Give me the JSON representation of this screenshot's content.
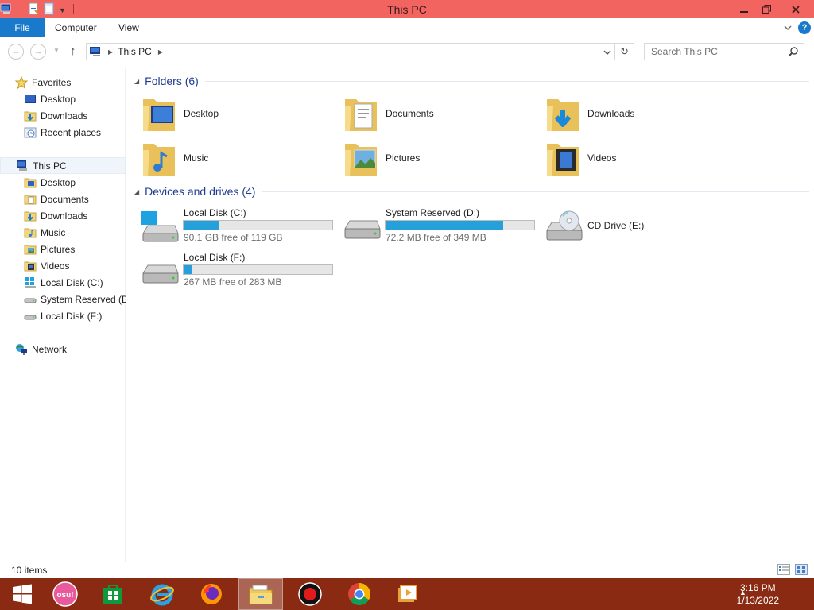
{
  "window": {
    "title": "This PC",
    "qat_icons": [
      "computer-icon",
      "properties-icon",
      "new-folder-icon",
      "customize-qat-icon"
    ],
    "controls": [
      "minimize",
      "restore",
      "close"
    ]
  },
  "ribbon": {
    "file_tab": "File",
    "tabs": [
      "Computer",
      "View"
    ],
    "expand_icon": "chevron-down-icon",
    "help_icon": "help-icon",
    "help_glyph": "?"
  },
  "navbar": {
    "breadcrumb": "This PC",
    "search_placeholder": "Search This PC"
  },
  "sidebar": {
    "favorites": {
      "label": "Favorites",
      "items": [
        "Desktop",
        "Downloads",
        "Recent places"
      ]
    },
    "this_pc": {
      "label": "This PC",
      "items": [
        "Desktop",
        "Documents",
        "Downloads",
        "Music",
        "Pictures",
        "Videos",
        "Local Disk (C:)",
        "System Reserved (D:)",
        "Local Disk (F:)"
      ]
    },
    "network": {
      "label": "Network"
    }
  },
  "folders": {
    "header": "Folders (6)",
    "items": [
      {
        "name": "Desktop",
        "icon": "desktop-folder-icon"
      },
      {
        "name": "Documents",
        "icon": "documents-folder-icon"
      },
      {
        "name": "Downloads",
        "icon": "downloads-folder-icon"
      },
      {
        "name": "Music",
        "icon": "music-folder-icon"
      },
      {
        "name": "Pictures",
        "icon": "pictures-folder-icon"
      },
      {
        "name": "Videos",
        "icon": "videos-folder-icon"
      }
    ]
  },
  "drives": {
    "header": "Devices and drives (4)",
    "items": [
      {
        "name": "Local Disk (C:)",
        "free": "90.1 GB free of 119 GB",
        "used_fraction": 0.24,
        "icon": "windows-drive-icon"
      },
      {
        "name": "System Reserved (D:)",
        "free": "72.2 MB free of 349 MB",
        "used_fraction": 0.79,
        "icon": "hard-drive-icon"
      },
      {
        "name": "CD Drive (E:)",
        "icon": "cd-drive-icon"
      },
      {
        "name": "Local Disk (F:)",
        "free": "267 MB free of 283 MB",
        "used_fraction": 0.06,
        "icon": "hard-drive-icon"
      }
    ]
  },
  "status": {
    "item_count": "10 items"
  },
  "taskbar": {
    "apps": [
      "windows-start-icon",
      "osu-icon",
      "store-icon",
      "internet-explorer-icon",
      "firefox-icon",
      "file-explorer-icon",
      "obs-icon",
      "chrome-icon",
      "media-player-icon"
    ],
    "osu_label": "osu!",
    "time": "3:16 PM",
    "date": "1/13/2022"
  },
  "colors": {
    "titlebar": "#f2645f",
    "accent": "#1979ca",
    "taskbar": "#8a2a12",
    "drive_bar": "#26a0da",
    "group_heading": "#1e3d8f"
  }
}
